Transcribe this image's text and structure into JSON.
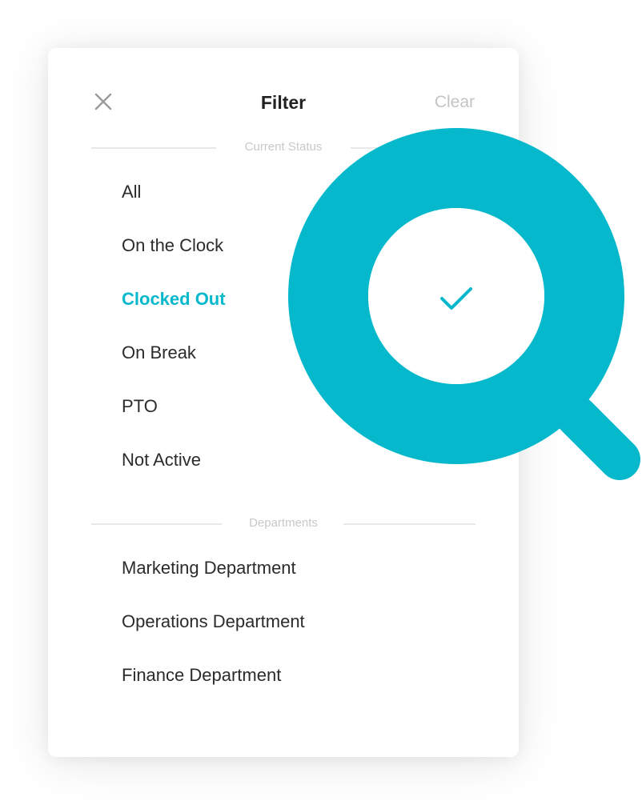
{
  "header": {
    "title": "Filter",
    "clear_label": "Clear",
    "close_icon": "close-icon"
  },
  "current_status": {
    "label": "Current Status",
    "items": [
      {
        "label": "All",
        "selected": false
      },
      {
        "label": "On the Clock",
        "selected": false
      },
      {
        "label": "Clocked Out",
        "selected": true
      },
      {
        "label": "On Break",
        "selected": false
      },
      {
        "label": "PTO",
        "selected": false
      },
      {
        "label": "Not Active",
        "selected": false
      }
    ]
  },
  "departments": {
    "label": "Departments",
    "items": [
      {
        "label": "Marketing Department"
      },
      {
        "label": "Operations Department"
      },
      {
        "label": "Finance Department"
      }
    ]
  },
  "decor": {
    "magnifier_icon": "magnifier-icon",
    "check_icon": "checkmark-icon"
  },
  "colors": {
    "accent": "#05b8cc",
    "text": "#2b2b2b",
    "muted": "#c4c4c4",
    "divider": "#e8e8e8"
  }
}
